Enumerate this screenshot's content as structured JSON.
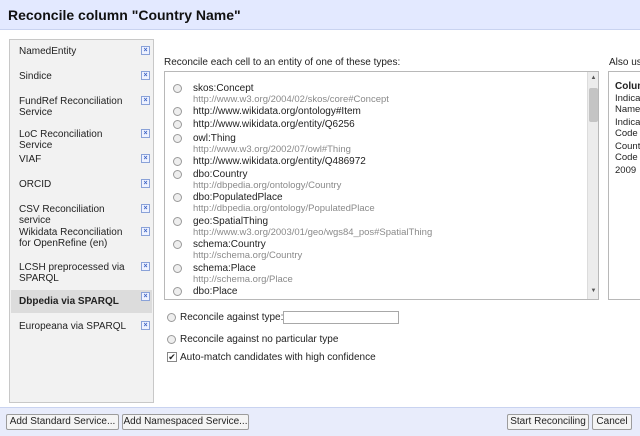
{
  "dialog": {
    "title": "Reconcile column \"Country Name\""
  },
  "services": [
    {
      "label": "NamedEntity",
      "selected": false
    },
    {
      "label": "Sindice",
      "selected": false
    },
    {
      "label": "FundRef Reconciliation Service",
      "selected": false
    },
    {
      "label": "LoC Reconciliation Service",
      "selected": false
    },
    {
      "label": "VIAF",
      "selected": false
    },
    {
      "label": "ORCID",
      "selected": false
    },
    {
      "label": "CSV Reconciliation service",
      "selected": false
    },
    {
      "label": "Wikidata Reconciliation for OpenRefine (en)",
      "selected": false
    },
    {
      "label": "LCSH preprocessed via SPARQL",
      "selected": false
    },
    {
      "label": "Dbpedia via SPARQL",
      "selected": true
    },
    {
      "label": "Europeana via SPARQL",
      "selected": false
    }
  ],
  "service_remove_glyph": "×",
  "types_heading": "Reconcile each cell to an entity of one of these types:",
  "types": [
    {
      "label": "skos:Concept",
      "uri": "http://www.w3.org/2004/02/skos/core#Concept"
    },
    {
      "label": "http://www.wikidata.org/ontology#Item",
      "uri": ""
    },
    {
      "label": "http://www.wikidata.org/entity/Q6256",
      "uri": ""
    },
    {
      "label": "owl:Thing",
      "uri": "http://www.w3.org/2002/07/owl#Thing"
    },
    {
      "label": "http://www.wikidata.org/entity/Q486972",
      "uri": ""
    },
    {
      "label": "dbo:Country",
      "uri": "http://dbpedia.org/ontology/Country"
    },
    {
      "label": "dbo:PopulatedPlace",
      "uri": "http://dbpedia.org/ontology/PopulatedPlace"
    },
    {
      "label": "geo:SpatialThing",
      "uri": "http://www.w3.org/2003/01/geo/wgs84_pos#SpatialThing"
    },
    {
      "label": "schema:Country",
      "uri": "http://schema.org/Country"
    },
    {
      "label": "schema:Place",
      "uri": "http://schema.org/Place"
    },
    {
      "label": "dbo:Place",
      "uri": ""
    }
  ],
  "options": {
    "against_type_label": "Reconcile against type:",
    "against_type_value": "",
    "no_type_label": "Reconcile against no particular type",
    "automatch_label": "Auto-match candidates with high confidence",
    "automatch_checked": true,
    "check_glyph": "✔"
  },
  "also_use": {
    "heading": "Also us",
    "column_header": "Colum",
    "items": [
      "Indica",
      "Name",
      "Indica",
      "Code",
      "Count",
      "Code",
      "2009"
    ]
  },
  "buttons": {
    "add_standard": "Add Standard Service...",
    "add_namespaced": "Add Namespaced Service...",
    "start": "Start Reconciling",
    "cancel": "Cancel"
  },
  "scroll_arrows": {
    "up": "▲",
    "down": "▼"
  }
}
